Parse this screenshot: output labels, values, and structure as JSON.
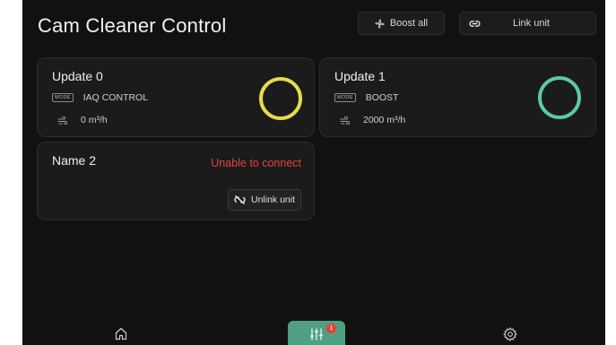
{
  "header": {
    "title": "Cam Cleaner Control",
    "boost_all_label": "Boost all",
    "link_unit_label": "Link unit"
  },
  "units": [
    {
      "name": "Update 0",
      "mode_badge": "MODE",
      "mode": "IAQ CONTROL",
      "airflow": "0 m³/h",
      "ring_color": "#e6dc4a"
    },
    {
      "name": "Update 1",
      "mode_badge": "MODE",
      "mode": "BOOST",
      "airflow": "2000 m³/h",
      "ring_color": "#5ec9a0"
    }
  ],
  "offline_unit": {
    "name": "Name 2",
    "status": "Unable to connect",
    "unlink_label": "Unlink unit",
    "status_color": "#e0433a"
  },
  "nav": {
    "badge_count": "1",
    "active_color": "#4fa083"
  }
}
